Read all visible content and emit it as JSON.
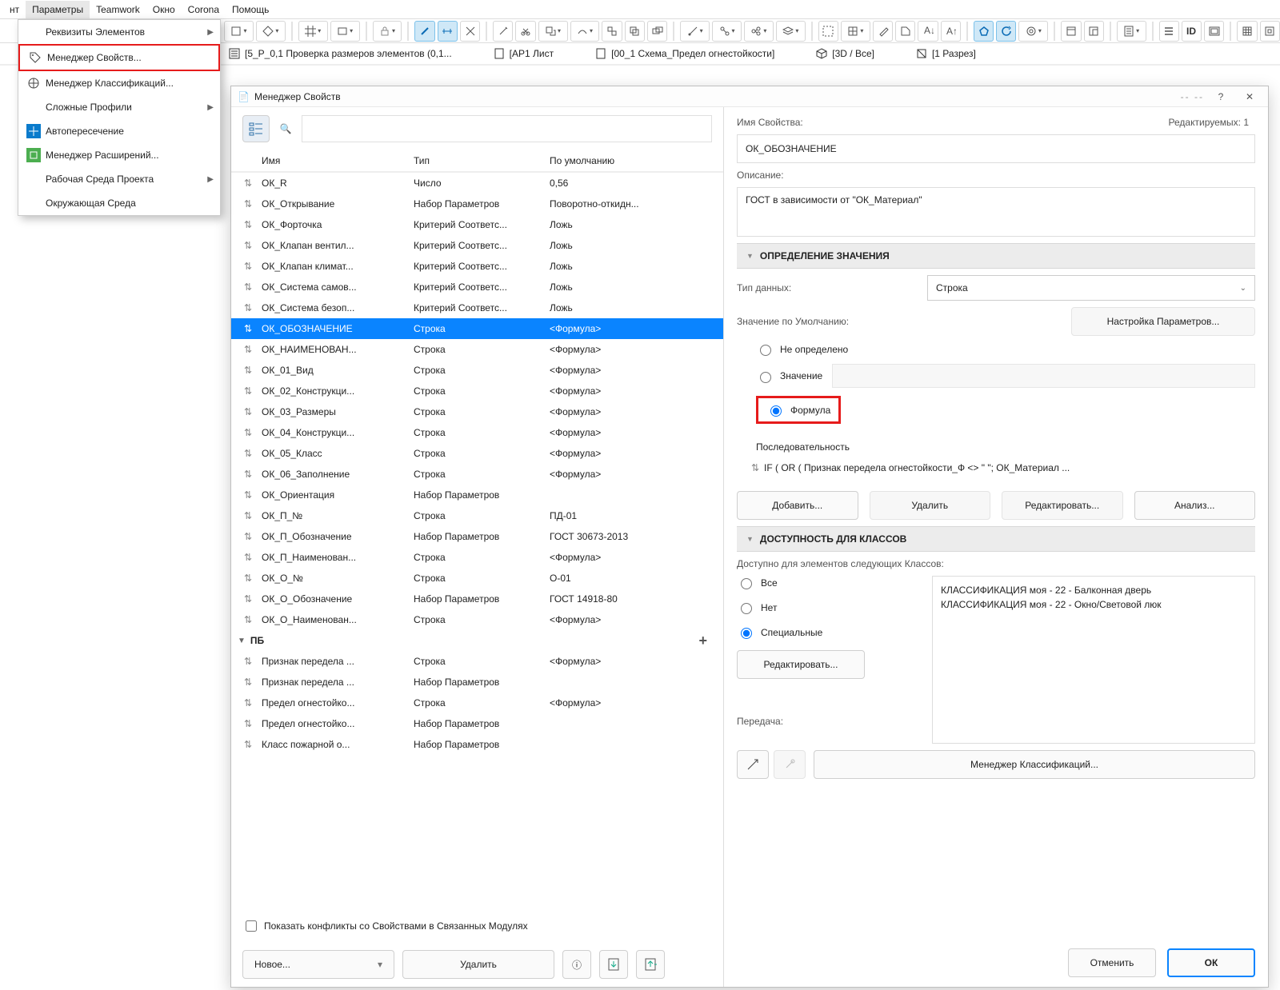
{
  "menubar": {
    "items": [
      "нт",
      "Параметры",
      "Teamwork",
      "Окно",
      "Corona",
      "Помощь"
    ],
    "active_index": 1
  },
  "dropdown_menu": {
    "items": [
      {
        "label": "Реквизиты Элементов",
        "icon": "",
        "has_sub": true
      },
      {
        "label": "Менеджер Свойств...",
        "icon": "tags",
        "highlight": true
      },
      {
        "label": "Менеджер Классификаций...",
        "icon": "class"
      },
      {
        "label": "Сложные Профили",
        "has_sub": true
      },
      {
        "label": "Автопересечение",
        "icon": "intersect"
      },
      {
        "label": "Менеджер Расширений...",
        "icon": "plugin"
      },
      {
        "label": "Рабочая Среда Проекта",
        "has_sub": true
      },
      {
        "label": "Окружающая Среда"
      }
    ]
  },
  "tabs": [
    {
      "label": "[5_Р_0,1 Проверка размеров элементов (0,1...",
      "icon": "checklist"
    },
    {
      "label": "[АР1 Лист",
      "icon": "sheet"
    },
    {
      "label": "[00_1 Схема_Предел огнестойкости]",
      "icon": "sheet"
    },
    {
      "label": "[3D / Все]",
      "icon": "cube"
    },
    {
      "label": "[1 Разрез]",
      "icon": "section"
    }
  ],
  "dialog": {
    "title": "Менеджер Свойств",
    "left": {
      "columns": {
        "name": "Имя",
        "type": "Тип",
        "default": "По умолчанию"
      },
      "rows": [
        {
          "name": "ОК_R",
          "type": "Число",
          "def": "0,56"
        },
        {
          "name": "ОК_Открывание",
          "type": "Набор Параметров",
          "def": "Поворотно-откидн..."
        },
        {
          "name": "ОК_Форточка",
          "type": "Критерий Соответс...",
          "def": "Ложь"
        },
        {
          "name": "ОК_Клапан вентил...",
          "type": "Критерий Соответс...",
          "def": "Ложь"
        },
        {
          "name": "ОК_Клапан климат...",
          "type": "Критерий Соответс...",
          "def": "Ложь"
        },
        {
          "name": "ОК_Система самов...",
          "type": "Критерий Соответс...",
          "def": "Ложь"
        },
        {
          "name": "ОК_Система безоп...",
          "type": "Критерий Соответс...",
          "def": "Ложь"
        },
        {
          "name": "ОК_ОБОЗНАЧЕНИЕ",
          "type": "Строка",
          "def": "<Формула>",
          "selected": true
        },
        {
          "name": "ОК_НАИМЕНОВАН...",
          "type": "Строка",
          "def": "<Формула>"
        },
        {
          "name": "ОК_01_Вид",
          "type": "Строка",
          "def": "<Формула>"
        },
        {
          "name": "ОК_02_Конструкци...",
          "type": "Строка",
          "def": "<Формула>"
        },
        {
          "name": "ОК_03_Размеры",
          "type": "Строка",
          "def": "<Формула>"
        },
        {
          "name": "ОК_04_Конструкци...",
          "type": "Строка",
          "def": "<Формула>"
        },
        {
          "name": "ОК_05_Класс",
          "type": "Строка",
          "def": "<Формула>"
        },
        {
          "name": "ОК_06_Заполнение",
          "type": "Строка",
          "def": "<Формула>"
        },
        {
          "name": "ОК_Ориентация",
          "type": "Набор Параметров",
          "def": ""
        },
        {
          "name": "ОК_П_№",
          "type": "Строка",
          "def": "ПД-01"
        },
        {
          "name": "ОК_П_Обозначение",
          "type": "Набор Параметров",
          "def": "ГОСТ 30673-2013"
        },
        {
          "name": "ОК_П_Наименован...",
          "type": "Строка",
          "def": "<Формула>"
        },
        {
          "name": "ОК_О_№",
          "type": "Строка",
          "def": "О-01"
        },
        {
          "name": "ОК_О_Обозначение",
          "type": "Набор Параметров",
          "def": "ГОСТ 14918-80"
        },
        {
          "name": "ОК_О_Наименован...",
          "type": "Строка",
          "def": "<Формула>"
        },
        {
          "group": "ПБ"
        },
        {
          "name": "Признак передела ...",
          "type": "Строка",
          "def": "<Формула>"
        },
        {
          "name": "Признак передела ...",
          "type": "Набор Параметров",
          "def": ""
        },
        {
          "name": "Предел огнестойко...",
          "type": "Строка",
          "def": "<Формула>"
        },
        {
          "name": "Предел огнестойко...",
          "type": "Набор Параметров",
          "def": ""
        },
        {
          "name": "Класс пожарной о...",
          "type": "Набор Параметров",
          "def": ""
        }
      ],
      "conflicts_label": "Показать конфликты со Свойствами в Связанных Модулях",
      "new_btn": "Новое...",
      "delete_btn": "Удалить"
    },
    "right": {
      "editable_label": "Редактируемых: 1",
      "name_label": "Имя Свойства:",
      "name_value": "ОК_ОБОЗНАЧЕНИЕ",
      "desc_label": "Описание:",
      "desc_value": "ГОСТ в зависимости от \"ОК_Материал\"",
      "section_def": "ОПРЕДЕЛЕНИЕ ЗНАЧЕНИЯ",
      "datatype_label": "Тип данных:",
      "datatype_value": "Строка",
      "defaultval_label": "Значение по Умолчанию:",
      "param_btn": "Настройка Параметров...",
      "radio_undef": "Не определено",
      "radio_value": "Значение",
      "radio_formula": "Формула",
      "formula_head": "Последовательность",
      "formula_text": "IF ( OR ( Признак передела огнестойкости_Ф <> \" \"; ОК_Материал ...",
      "btns": {
        "add": "Добавить...",
        "del": "Удалить",
        "edit": "Редактировать...",
        "analyze": "Анализ..."
      },
      "section_avail": "ДОСТУПНОСТЬ ДЛЯ КЛАССОВ",
      "avail_label": "Доступно для элементов следующих Классов:",
      "avail_radios": {
        "all": "Все",
        "none": "Нет",
        "special": "Специальные"
      },
      "avail_edit": "Редактировать...",
      "classes": [
        "КЛАССИФИКАЦИЯ моя - 22 - Балконная дверь",
        "КЛАССИФИКАЦИЯ моя - 22 - Окно/Световой люк"
      ],
      "transfer_label": "Передача:",
      "classmgr": "Менеджер Классификаций...",
      "cancel": "Отменить",
      "ok": "ОК"
    }
  }
}
